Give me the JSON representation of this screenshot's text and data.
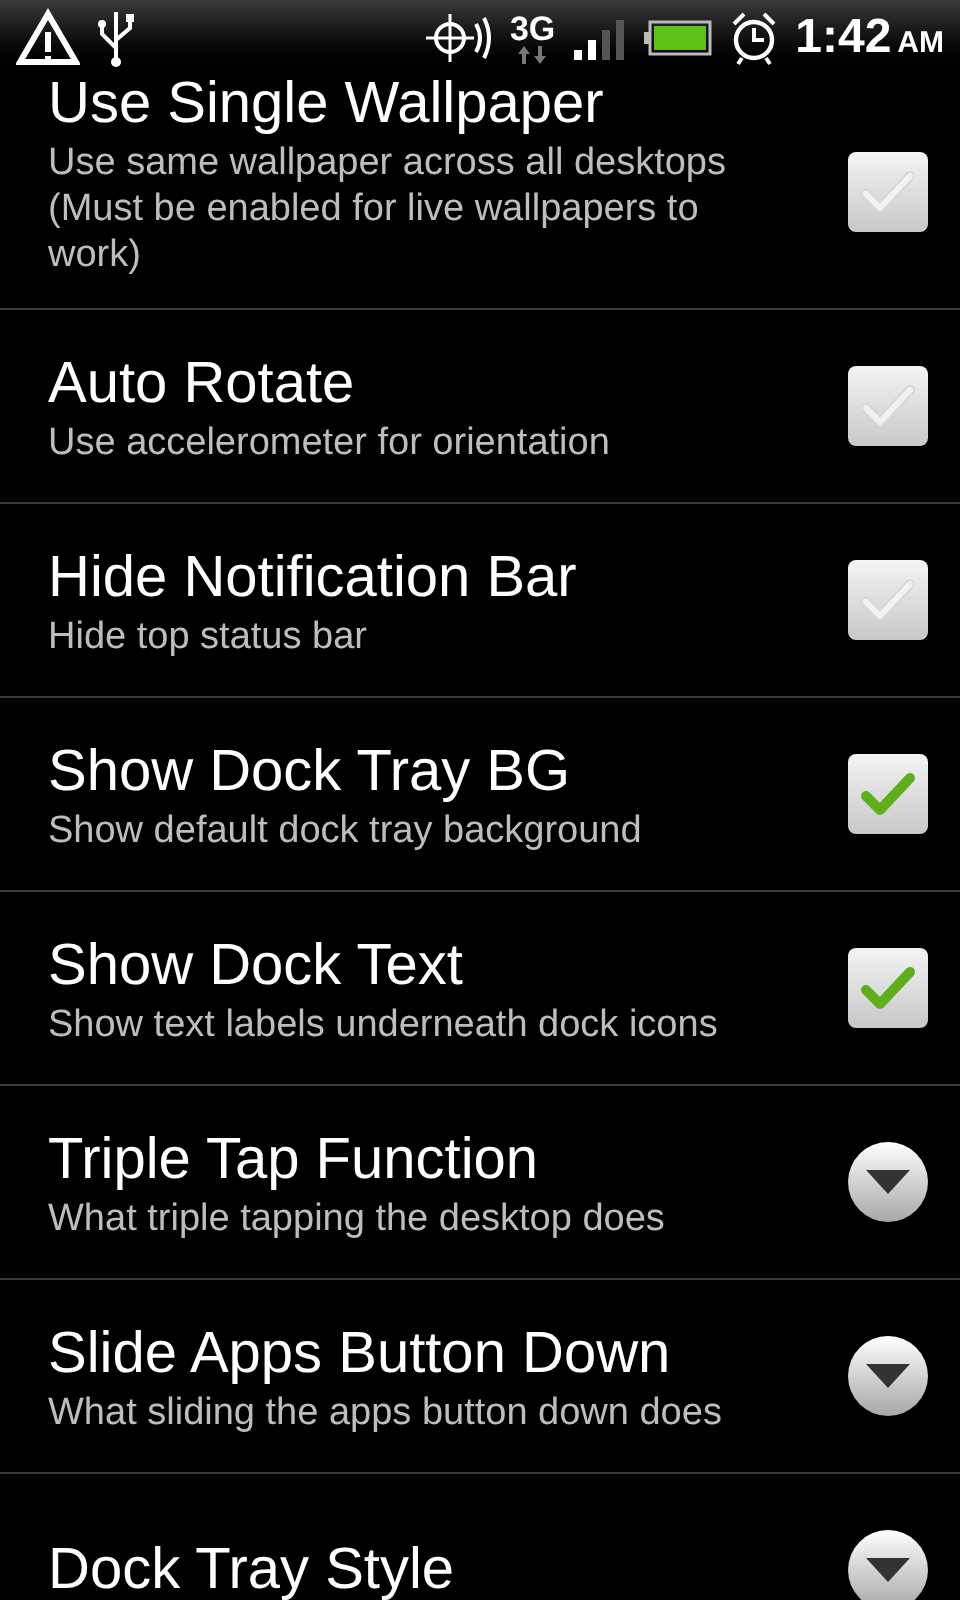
{
  "status_bar": {
    "network": "3G",
    "time": "1:42",
    "meridiem": "AM"
  },
  "preferences": [
    {
      "kind": "checkbox",
      "title": "Use Single Wallpaper",
      "summary": "Use same wallpaper across all desktops (Must be enabled for live wallpapers to work)",
      "checked": false
    },
    {
      "kind": "checkbox",
      "title": "Auto Rotate",
      "summary": "Use accelerometer for orientation",
      "checked": false
    },
    {
      "kind": "checkbox",
      "title": "Hide Notification Bar",
      "summary": "Hide top status bar",
      "checked": false
    },
    {
      "kind": "checkbox",
      "title": "Show Dock Tray BG",
      "summary": "Show default dock tray background",
      "checked": true
    },
    {
      "kind": "checkbox",
      "title": "Show Dock Text",
      "summary": "Show text labels underneath dock icons",
      "checked": true
    },
    {
      "kind": "list",
      "title": "Triple Tap Function",
      "summary": "What triple tapping the desktop does"
    },
    {
      "kind": "list",
      "title": "Slide Apps Button Down",
      "summary": "What sliding the apps button down does"
    },
    {
      "kind": "list",
      "title": "Dock Tray Style"
    }
  ]
}
